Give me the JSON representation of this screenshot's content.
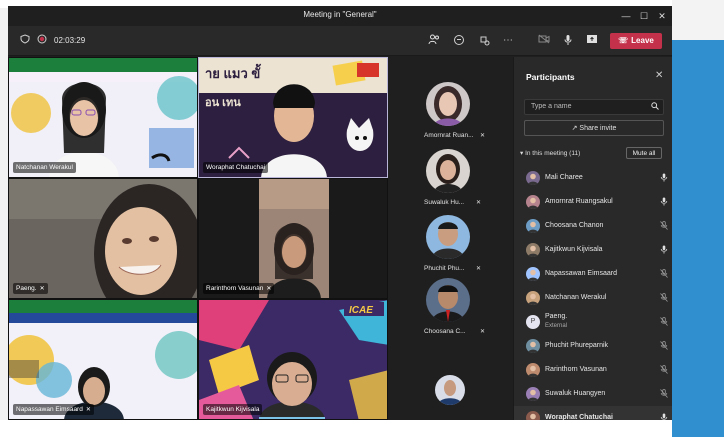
{
  "window": {
    "title": "Meeting in \"General\"",
    "timer": "02:03:29",
    "leave_label": "Leave"
  },
  "stage_tiles": [
    {
      "name": "Natchanan Werakul",
      "muted": false,
      "bg": "#e9e7f2"
    },
    {
      "name": "Woraphat Chatuchai",
      "muted": false,
      "bg": "#2a1d3a"
    },
    {
      "name": "Paeng.",
      "muted": true,
      "bg": "#5e5a55"
    },
    {
      "name": "Rarinthorn Vasunan",
      "muted": true,
      "bg": "#a38a7a"
    },
    {
      "name": "Napassawan Eimsaard",
      "muted": true,
      "bg": "#e9e7f2"
    },
    {
      "name": "Kajitkwun Kijvisala",
      "muted": false,
      "bg": "#3b2a66"
    }
  ],
  "strip": [
    {
      "name": "Amornrat Ruan...",
      "muted": true
    },
    {
      "name": "Suwaluk Hu...",
      "muted": true
    },
    {
      "name": "Phuchit Phu...",
      "muted": true
    },
    {
      "name": "Choosana C...",
      "muted": true
    },
    {
      "name": "",
      "muted": false
    }
  ],
  "panel": {
    "title": "Participants",
    "search_placeholder": "Type a name",
    "invite_label": "Share invite",
    "section_label": "In this meeting (11)",
    "mute_all_label": "Mute all",
    "participants": [
      {
        "name": "Mali Charee",
        "sub": "",
        "muted": false
      },
      {
        "name": "Amornrat Ruangsakul",
        "sub": "",
        "muted": false
      },
      {
        "name": "Choosana Chanon",
        "sub": "",
        "muted": true
      },
      {
        "name": "Kajitkwun Kijvisala",
        "sub": "",
        "muted": false
      },
      {
        "name": "Napassawan Eimsaard",
        "sub": "",
        "muted": true
      },
      {
        "name": "Natchanan Werakul",
        "sub": "",
        "muted": true
      },
      {
        "name": "Paeng.",
        "sub": "External",
        "muted": true,
        "initial": "P"
      },
      {
        "name": "Phuchit Phureparnik",
        "sub": "",
        "muted": true
      },
      {
        "name": "Rarinthorn Vasunan",
        "sub": "",
        "muted": true
      },
      {
        "name": "Suwaluk Huangyen",
        "sub": "",
        "muted": true
      },
      {
        "name": "Woraphat Chatuchai",
        "sub": "",
        "muted": false
      }
    ]
  },
  "icons": {
    "shield": "shield-icon",
    "record": "record-icon",
    "people": "people-icon",
    "chat": "chat-icon",
    "react": "react-icon",
    "more": "more-icon",
    "camera": "camera-icon",
    "mic": "mic-icon",
    "share": "share-icon",
    "search": "search-icon",
    "close": "close-icon"
  },
  "colors": {
    "leave": "#c4314b",
    "panel_bg": "#292929"
  }
}
